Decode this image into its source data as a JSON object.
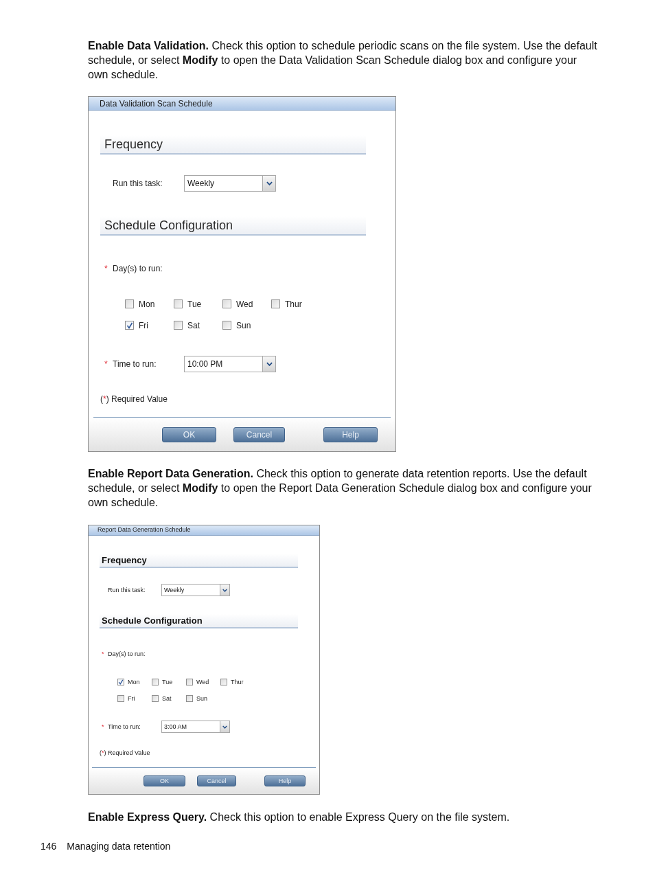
{
  "page": [
    {
      "kind": "paragraph",
      "text": "**Enable Data Validation.** Check this option to schedule periodic scans on the file system. Use the default schedule, or select **Modify** to open the Data Validation Scan Schedule dialog box and configure your own schedule."
    },
    {
      "kind": "dialog",
      "title": "Data Validation Scan Schedule",
      "frequency": {
        "heading": "Frequency",
        "label": {
          "text": "Run this task:"
        },
        "value": "Weekly"
      },
      "schedule": {
        "heading": "Schedule Configuration",
        "days_label": {
          "mark": "*",
          "text": "Day(s) to run:"
        },
        "days": [
          {
            "label": "Mon",
            "checked": false
          },
          {
            "label": "Tue",
            "checked": false
          },
          {
            "label": "Wed",
            "checked": false
          },
          {
            "label": "Thur",
            "checked": false
          },
          {
            "label": "Fri",
            "checked": true
          },
          {
            "label": "Sat",
            "checked": false
          },
          {
            "label": "Sun",
            "checked": false
          }
        ],
        "time_label": {
          "mark": "*",
          "text": "Time to run:"
        },
        "time_value": "10:00 PM"
      },
      "required_note": {
        "before": "(",
        "mark": "*",
        "after": ") Required Value"
      },
      "buttons": [
        "OK",
        "Cancel",
        "Help"
      ]
    },
    {
      "kind": "paragraph",
      "text": "**Enable Report Data Generation.** Check this option to generate data retention reports. Use the default schedule, or select **Modify** to open the Report Data Generation Schedule dialog box and configure your own schedule."
    },
    {
      "kind": "dialog",
      "title": "Report Data Generation Schedule",
      "frequency": {
        "heading": "Frequency",
        "label": {
          "text": "Run this task:"
        },
        "value": "Weekly"
      },
      "schedule": {
        "heading": "Schedule Configuration",
        "days_label": {
          "mark": "*",
          "text": "Day(s) to run:"
        },
        "days": [
          {
            "label": "Mon",
            "checked": true
          },
          {
            "label": "Tue",
            "checked": false
          },
          {
            "label": "Wed",
            "checked": false
          },
          {
            "label": "Thur",
            "checked": false
          },
          {
            "label": "Fri",
            "checked": false
          },
          {
            "label": "Sat",
            "checked": false
          },
          {
            "label": "Sun",
            "checked": false
          }
        ],
        "time_label": {
          "mark": "*",
          "text": "Time to run:"
        },
        "time_value": "3:00 AM"
      },
      "required_note": {
        "before": "(",
        "mark": "*",
        "after": ") Required Value"
      },
      "buttons": [
        "OK",
        "Cancel",
        "Help"
      ]
    },
    {
      "kind": "paragraph",
      "text": "**Enable Express Query.** Check this option to enable Express Query on the file system."
    }
  ],
  "footer": {
    "page_number": "146",
    "title": "Managing data retention"
  }
}
